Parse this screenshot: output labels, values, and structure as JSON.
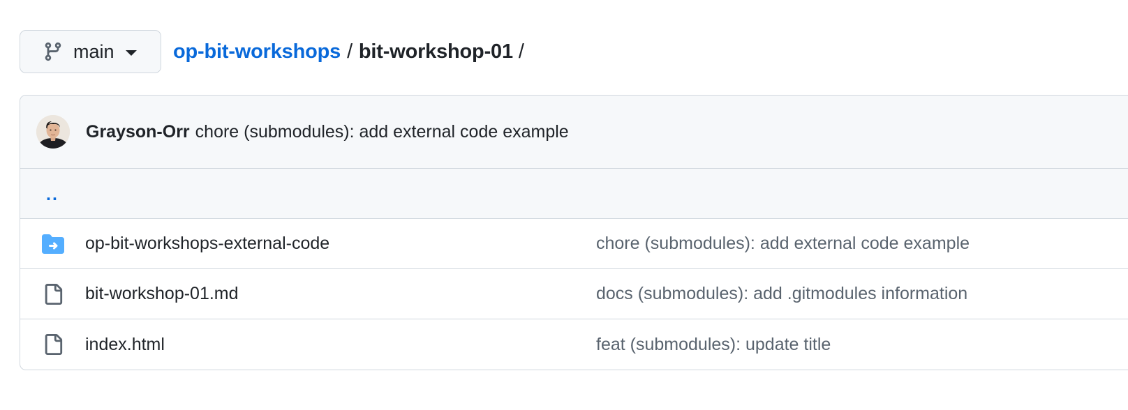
{
  "branch": {
    "name": "main",
    "icon": "git-branch-icon"
  },
  "breadcrumb": {
    "repo": "op-bit-workshops",
    "separator": "/",
    "current": "bit-workshop-01",
    "trailing": "/"
  },
  "latest_commit": {
    "author": "Grayson-Orr",
    "message": "chore (submodules): add external code example"
  },
  "parent_dir": {
    "label": ".."
  },
  "files": [
    {
      "name": "op-bit-workshops-external-code",
      "type": "submodule",
      "icon": "submodule-folder-icon",
      "commit": "chore (submodules): add external code example"
    },
    {
      "name": "bit-workshop-01.md",
      "type": "file",
      "icon": "file-icon",
      "commit": "docs (submodules): add .gitmodules information"
    },
    {
      "name": "index.html",
      "type": "file",
      "icon": "file-icon",
      "commit": "feat (submodules): update title"
    }
  ],
  "colors": {
    "link": "#0969da",
    "text": "#1f2328",
    "muted": "#59636e",
    "border": "#d0d7de",
    "header_bg": "#f6f8fa",
    "submodule_folder": "#54aeff"
  }
}
